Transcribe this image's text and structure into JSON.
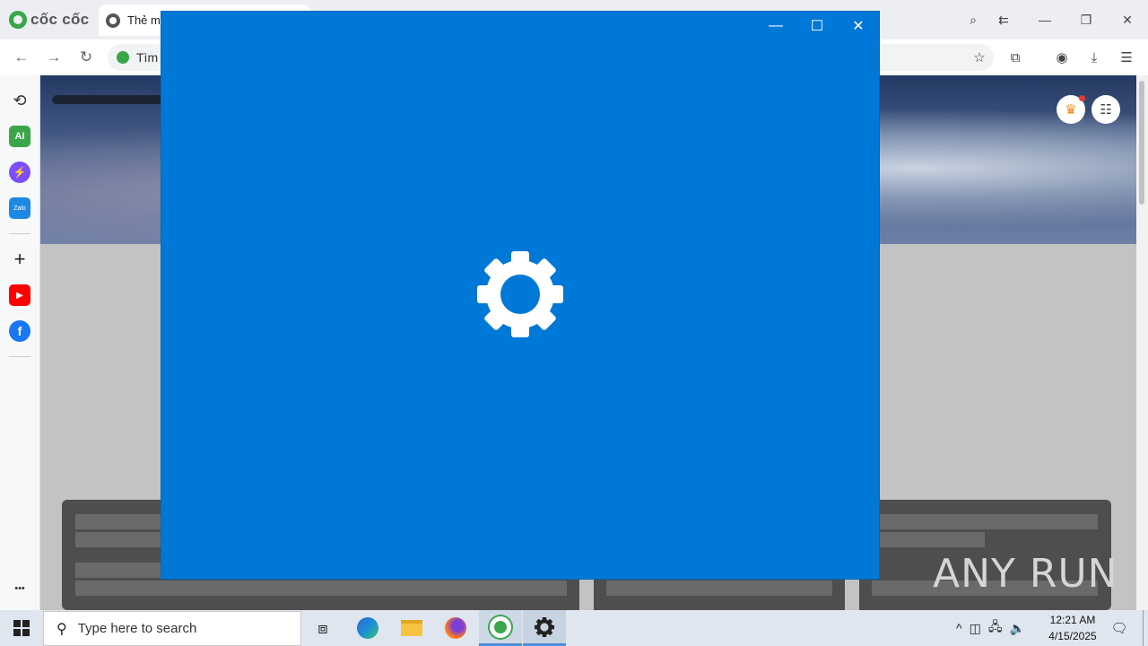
{
  "browser": {
    "brand": "cốc cốc",
    "tab_title": "Thẻ m",
    "address_text": "Tìm",
    "colors": {
      "brand_green": "#3aa64a"
    },
    "window_controls": [
      "minimize-icon",
      "restore-icon",
      "close-icon"
    ],
    "toolbar_icons": [
      "bookmark-star-icon",
      "extensions-icon",
      "profile-icon",
      "download-icon",
      "menu-icon"
    ]
  },
  "sidebar": {
    "items": [
      {
        "name": "history-icon",
        "glyph": "⟲"
      },
      {
        "name": "ai-icon",
        "glyph": "AI"
      },
      {
        "name": "messenger-icon",
        "glyph": "⚡"
      },
      {
        "name": "zalo-icon",
        "glyph": "Zalo"
      },
      {
        "name": "add-icon",
        "glyph": "+"
      },
      {
        "name": "youtube-icon",
        "glyph": "▶"
      },
      {
        "name": "facebook-icon",
        "glyph": "f"
      },
      {
        "name": "more-icon",
        "glyph": "•••"
      }
    ]
  },
  "splash": {
    "app": "Settings",
    "background_color": "#0078d7",
    "icon": "gear-icon"
  },
  "watermark": "ANY RUN",
  "taskbar": {
    "search_placeholder": "Type here to search",
    "apps": [
      "task-view-icon",
      "edge-icon",
      "file-explorer-icon",
      "firefox-icon",
      "coccoc-icon",
      "settings-icon"
    ],
    "clock_time": "12:21 AM",
    "clock_date": "4/15/2025"
  }
}
